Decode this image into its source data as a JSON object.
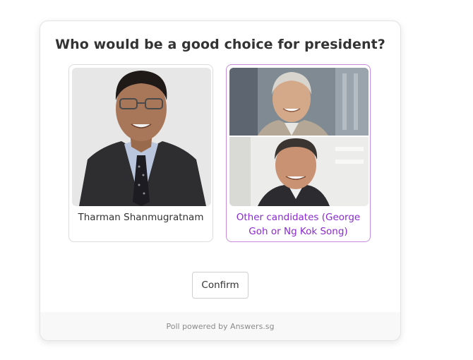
{
  "poll": {
    "question": "Who would be a good choice for president?",
    "options": [
      {
        "label": "Tharman Shanmugratnam",
        "selected": false
      },
      {
        "label": "Other candidates (George Goh or Ng Kok Song)",
        "selected": true
      }
    ],
    "confirm_label": "Confirm",
    "footer": "Poll powered by Answers.sg"
  },
  "colors": {
    "accent": "#8a2ad0",
    "selected_border": "#c78ce0",
    "card_border": "#e3e3e3",
    "footer_bg": "#f8f8f8"
  }
}
